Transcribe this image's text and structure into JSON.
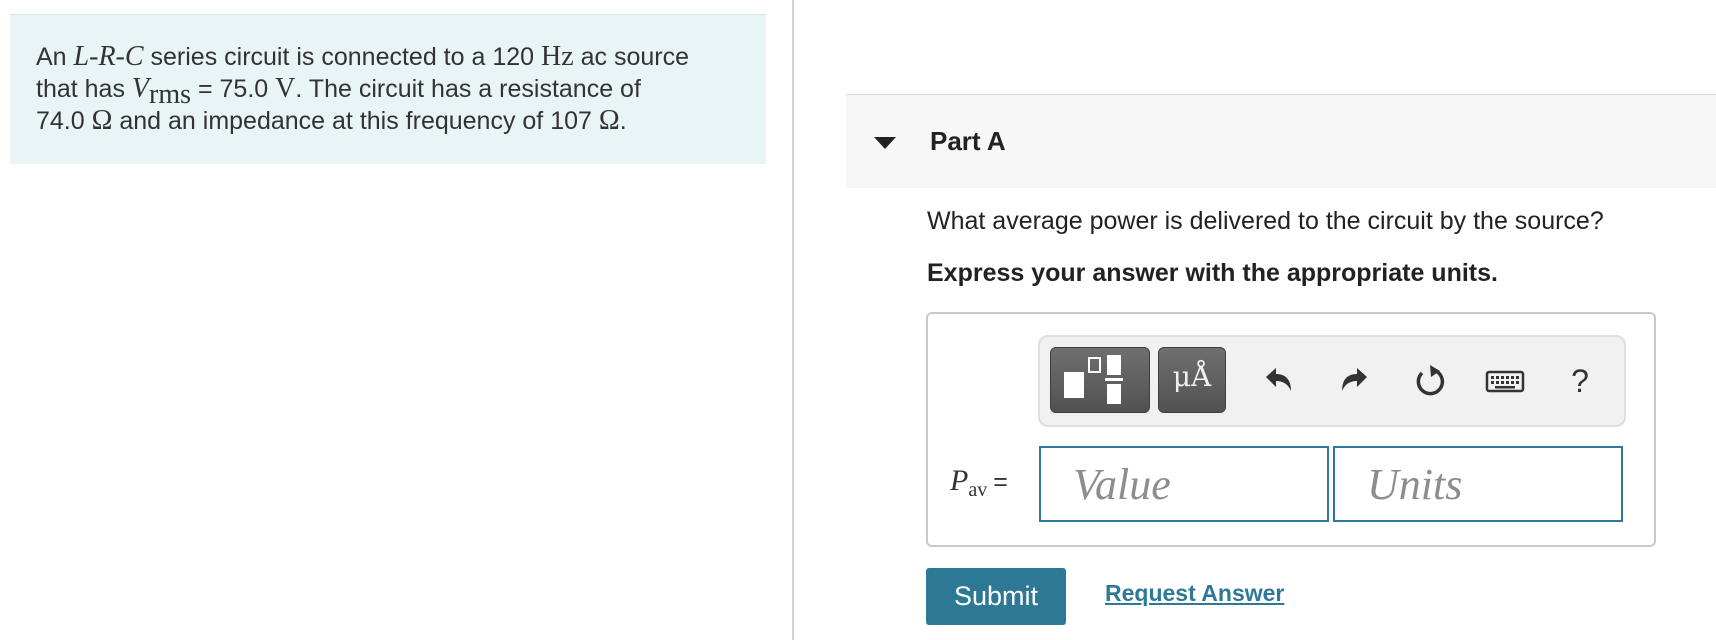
{
  "problem": {
    "t1": "An ",
    "m_L": "L",
    "m_dash1": "-",
    "m_R": "R",
    "m_dash2": "-",
    "m_C": "C",
    "t2": " series circuit is connected to a 120 ",
    "m_hz": "Hz",
    "t3": " ac source",
    "t4": "that has ",
    "m_V": "V",
    "m_rms": "rms",
    "t5": " = 75.0 ",
    "m_volt": "V",
    "t6": ". The circuit has a resistance of",
    "t7": "74.0 ",
    "m_ohm1": "Ω",
    "t8": " and an impedance at this frequency of 107 ",
    "m_ohm2": "Ω",
    "t9": "."
  },
  "part": {
    "title": "Part A",
    "question": "What average power is delivered to the circuit by the source?",
    "instruction": "Express your answer with the appropriate units."
  },
  "toolbar": {
    "units_label": "μÅ",
    "help_label": "?",
    "icons": [
      "templates-icon",
      "units-icon",
      "undo-icon",
      "redo-icon",
      "reset-icon",
      "keyboard-icon",
      "help-icon"
    ]
  },
  "answer": {
    "var_symbol": "P",
    "var_sub": "av",
    "equals": "=",
    "value_placeholder": "Value",
    "units_placeholder": "Units"
  },
  "actions": {
    "submit_label": "Submit",
    "request_label": "Request Answer"
  },
  "colors": {
    "problem_bg": "#e8f4f6",
    "accent": "#2d7895",
    "field_border": "#2f7a9c"
  }
}
